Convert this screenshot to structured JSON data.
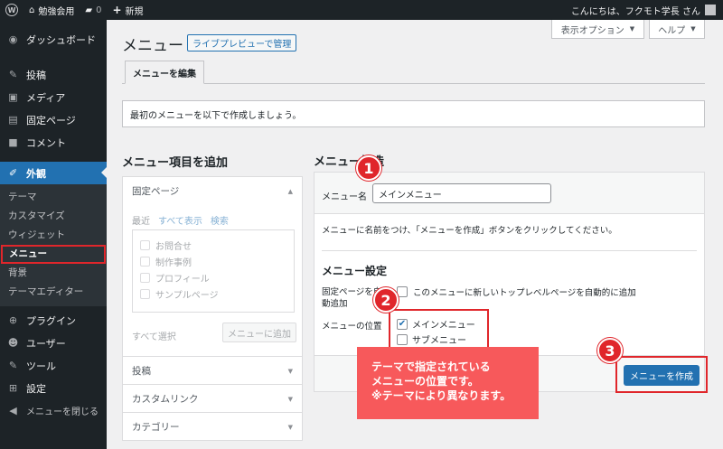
{
  "adminbar": {
    "site_name": "勉強会用",
    "comments": "0",
    "new_label": "新規",
    "greeting": "こんにちは、フクモト学長 さん"
  },
  "sidebar": {
    "items_top": [
      {
        "icon": "◉",
        "label": "ダッシュボード"
      },
      {
        "icon": "✎",
        "label": "投稿"
      },
      {
        "icon": "▣",
        "label": "メディア"
      },
      {
        "icon": "▤",
        "label": "固定ページ"
      },
      {
        "icon": "■",
        "label": "コメント"
      }
    ],
    "current": {
      "icon": "✐",
      "label": "外観"
    },
    "submenu": [
      "テーマ",
      "カスタマイズ",
      "ウィジェット",
      "メニュー",
      "背景",
      "テーマエディター"
    ],
    "items_bottom": [
      {
        "icon": "⊕",
        "label": "プラグイン"
      },
      {
        "icon": "☻",
        "label": "ユーザー"
      },
      {
        "icon": "✎",
        "label": "ツール"
      },
      {
        "icon": "⊞",
        "label": "設定"
      },
      {
        "icon": "◀",
        "label": "メニューを閉じる"
      }
    ]
  },
  "header": {
    "title": "メニュー",
    "live_preview": "ライブプレビューで管理",
    "screen_options": "表示オプション",
    "help": "ヘルプ",
    "tab": "メニューを編集",
    "notice": "最初のメニューを以下で作成しましょう。"
  },
  "add_items": {
    "heading": "メニュー項目を追加",
    "pages": "固定ページ",
    "tabs": [
      "最近",
      "すべて表示",
      "検索"
    ],
    "page_list": [
      "お問合せ",
      "制作事例",
      "プロフィール",
      "サンプルページ"
    ],
    "select_all": "すべて選択",
    "add_button": "メニューに追加",
    "sections": [
      "投稿",
      "カスタムリンク",
      "カテゴリー"
    ]
  },
  "structure": {
    "heading": "メニュー構造",
    "name_label": "メニュー名",
    "name_value": "メインメニュー",
    "help": "メニューに名前をつけ、「メニューを作成」ボタンをクリックしてください。",
    "settings_heading": "メニュー設定",
    "auto_label": "固定ページを自動追加",
    "auto_option": "このメニューに新しいトップレベルページを自動的に追加",
    "position_label": "メニューの位置",
    "locations": [
      {
        "label": "メインメニュー",
        "checked": true
      },
      {
        "label": "サブメニュー",
        "checked": false
      }
    ],
    "create_button": "メニューを作成"
  },
  "annotations": {
    "badges": [
      "1",
      "2",
      "3"
    ],
    "callout": [
      "テーマで指定されている",
      "メニューの位置です。",
      "※テーマにより異なります。"
    ]
  },
  "colors": {
    "accent": "#2271b1",
    "annotation": "#e0262b",
    "callout": "#f7595b",
    "sidebar": "#1d2327"
  }
}
